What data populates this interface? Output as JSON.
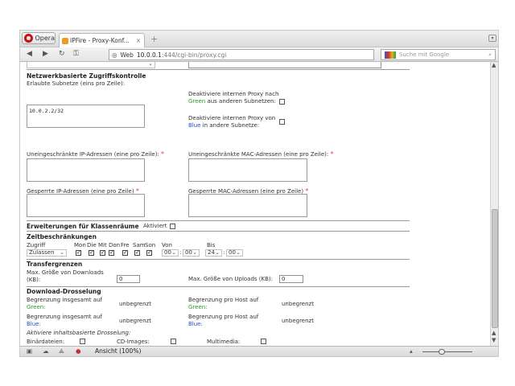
{
  "browser": {
    "menu_label": "Opera",
    "tab_title": "IPFire - Proxy-Konf...",
    "tab_close": "×",
    "new_tab": "+",
    "addr_prefix": "Web",
    "addr_host": "10.0.0.1",
    "addr_path": ":444/cgi-bin/proxy.cgi",
    "search_placeholder": "Suche mit Google",
    "zoom_label": "Ansicht (100%)"
  },
  "colors": {
    "green": "#2a9a2a",
    "blue": "#2a4ad0",
    "required": "#e03a3a"
  },
  "network": {
    "title": "Netzwerkbasierte Zugriffskontrolle",
    "subnets_label": "Erlaubte Subnetze (eins pro Zeile):",
    "subnets_value": "10.0.2.2/32",
    "disable_green_pre": "Deaktiviere internen Proxy nach",
    "disable_green_color": "Green",
    "disable_green_post": "aus anderen Subnetzen:",
    "disable_blue_pre": "Deaktiviere internen Proxy von",
    "disable_blue_color": "Blue",
    "disable_blue_post": "in andere Subnetze:",
    "unrestricted_ip_label": "Uneingeschränkte IP-Adressen (eine pro Zeile):",
    "unrestricted_mac_label": "Uneingeschränkte MAC-Adressen (eine pro Zeile):",
    "blocked_ip_label": "Gesperrte IP-Adressen (eine pro Zeile)",
    "blocked_mac_label": "Gesperrte MAC-Adressen (eine pro Zeile)",
    "required_mark": "*"
  },
  "classroom": {
    "title": "Erweiterungen für Klassenräume",
    "activated_label": "Aktiviert"
  },
  "time": {
    "title": "Zeitbeschränkungen",
    "access_label": "Zugriff",
    "access_value": "Zulassen",
    "days": [
      "Mon",
      "Die",
      "Mit",
      "Don",
      "Fre",
      "Sam",
      "Son"
    ],
    "from_label": "Von",
    "to_label": "Bis",
    "from_hour": "00",
    "from_min": "00",
    "to_hour": "24",
    "to_min": "00",
    "colon": ":"
  },
  "transfer": {
    "title": "Transfergrenzen",
    "download_label": "Max. Größe von Downloads (KB):",
    "download_value": "0",
    "upload_label": "Max. Größe von Uploads (KB):",
    "upload_value": "0"
  },
  "throttle": {
    "title": "Download-Drosselung",
    "green_total_pre": "Begrenzung insgesamt auf",
    "green_host_pre": "Begrenzung pro Host auf",
    "blue_total_pre": "Begrenzung insgesamt auf",
    "blue_host_pre": "Begrenzung pro Host auf",
    "green": "Green:",
    "blue": "Blue:",
    "unlimited": "unbegrenzt",
    "content_based": "Aktiviere inhaltsbasierte Drosselung:",
    "binaries": "Binärdateien:",
    "cd_images": "CD-Images:",
    "multimedia": "Multimedia:"
  }
}
